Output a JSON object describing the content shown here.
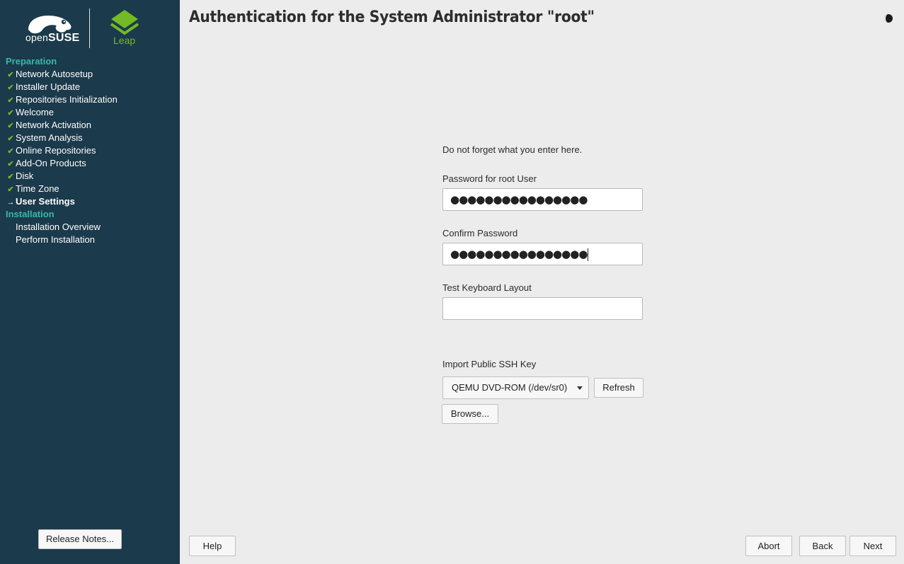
{
  "sidebar": {
    "brand": {
      "opensuse_prefix": "open",
      "opensuse_suffix": "SUSE",
      "product": "Leap"
    },
    "sections": [
      {
        "title": "Preparation",
        "steps": [
          {
            "label": "Network Autosetup",
            "status": "done"
          },
          {
            "label": "Installer Update",
            "status": "done"
          },
          {
            "label": "Repositories Initialization",
            "status": "done"
          },
          {
            "label": "Welcome",
            "status": "done"
          },
          {
            "label": "Network Activation",
            "status": "done"
          },
          {
            "label": "System Analysis",
            "status": "done"
          },
          {
            "label": "Online Repositories",
            "status": "done"
          },
          {
            "label": "Add-On Products",
            "status": "done"
          },
          {
            "label": "Disk",
            "status": "done"
          },
          {
            "label": "Time Zone",
            "status": "done"
          },
          {
            "label": "User Settings",
            "status": "current"
          }
        ]
      },
      {
        "title": "Installation",
        "steps": [
          {
            "label": "Installation Overview",
            "status": "pending"
          },
          {
            "label": "Perform Installation",
            "status": "pending"
          }
        ]
      }
    ],
    "release_notes_label": "Release Notes..."
  },
  "header": {
    "title": "Authentication for the System Administrator \"root\""
  },
  "form": {
    "intro": "Do not forget what you enter here.",
    "password_label": "Password for root User",
    "password_value": "●●●●●●●●●●●●●●●●",
    "confirm_label": "Confirm Password",
    "confirm_value": "●●●●●●●●●●●●●●●●",
    "keyboard_label": "Test Keyboard Layout",
    "keyboard_value": "",
    "ssh_label": "Import Public SSH Key",
    "ssh_device": "QEMU DVD-ROM (/dev/sr0)",
    "refresh_label": "Refresh",
    "browse_label": "Browse..."
  },
  "footer": {
    "help_label": "Help",
    "abort_label": "Abort",
    "back_label": "Back",
    "next_label": "Next"
  },
  "colors": {
    "sidebar_bg": "#1b3a4b",
    "section_title": "#35b9ab",
    "check": "#73ba25",
    "leap_green": "#73ba25",
    "main_bg": "#ececec"
  },
  "icons": {
    "done": "check-icon",
    "current": "arrow-right-icon",
    "theme": "half-moon-icon"
  }
}
